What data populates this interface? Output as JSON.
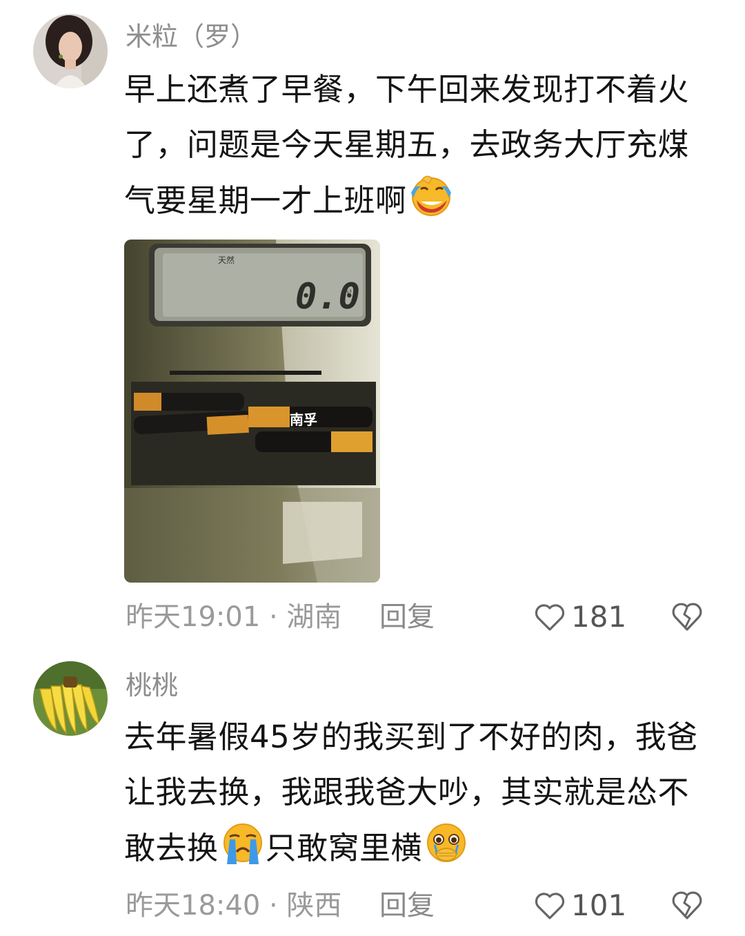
{
  "comments": [
    {
      "username": "米粒（罗）",
      "text": "早上还煮了早餐，下午回来发现打不着火了，问题是今天星期五，去政务大厅充煤气要星期一才上班啊",
      "text_emoji": "tears-of-joy-emoji",
      "photo": {
        "display_label": "天然",
        "reading": "0.0",
        "unit": "m³",
        "battery_brand": "南孚"
      },
      "time_location": "昨天19:01 · 湖南",
      "reply_label": "回复",
      "like_count": "181"
    },
    {
      "username": "桃桃",
      "text_parts": [
        "去年暑假45岁的我买到了不好的肉，我爸让我去换，我跟我爸大吵，其实就是怂不敢去换",
        "只敢窝里横"
      ],
      "emojis": [
        "loudly-crying-emoji",
        "pleading-hand-over-mouth-emoji"
      ],
      "time_location": "昨天18:40 · 陕西",
      "reply_label": "回复",
      "like_count": "101"
    }
  ],
  "colors": {
    "username": "#8d8d8d",
    "text": "#141414",
    "meta": "#9a9a9a"
  }
}
